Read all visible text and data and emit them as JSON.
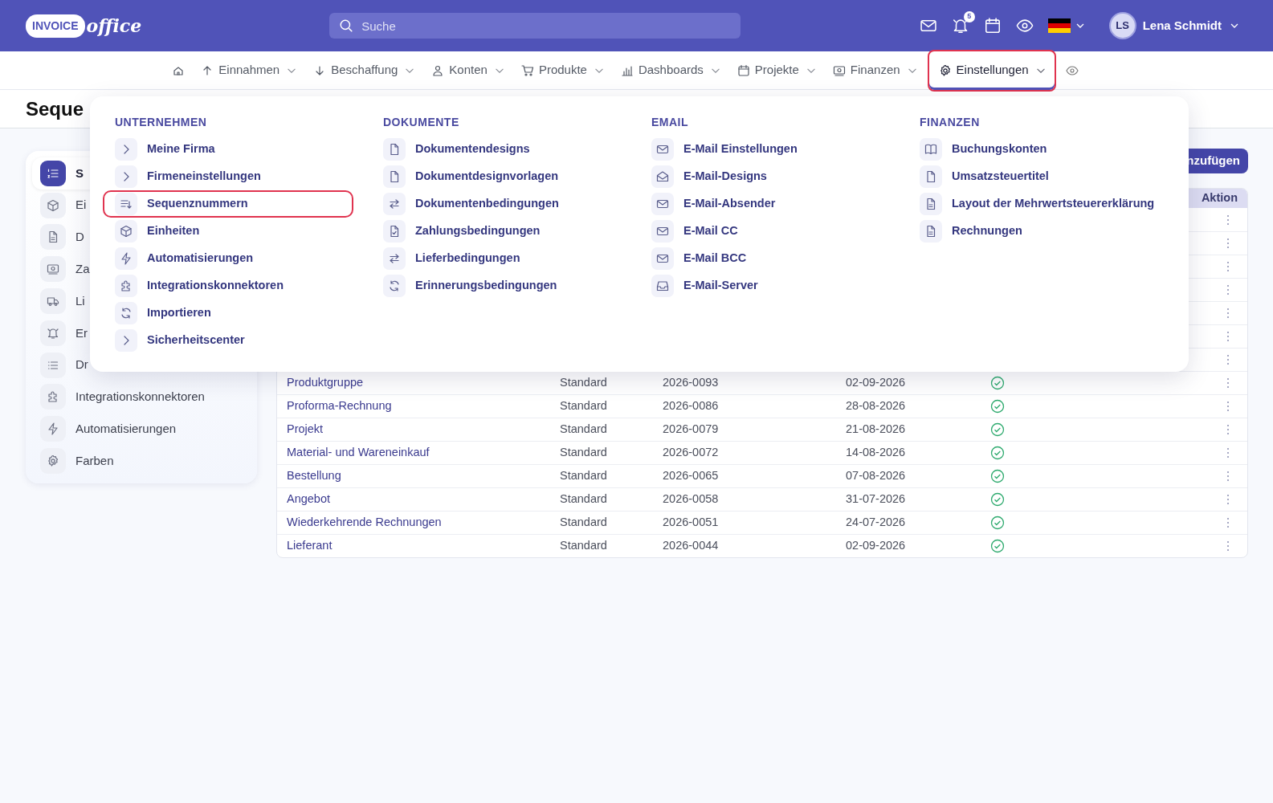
{
  "topbar": {
    "logo": {
      "badge_text": "INVOICE",
      "script_text": "office"
    },
    "search": {
      "placeholder": "Suche"
    },
    "notifications_count": "5",
    "user": {
      "initials": "LS",
      "name": "Lena Schmidt"
    }
  },
  "nav": {
    "items": [
      {
        "label": "Einnahmen",
        "selected": false
      },
      {
        "label": "Beschaffung",
        "selected": false
      },
      {
        "label": "Konten",
        "selected": false
      },
      {
        "label": "Produkte",
        "selected": false
      },
      {
        "label": "Dashboards",
        "selected": false
      },
      {
        "label": "Projekte",
        "selected": false
      },
      {
        "label": "Finanzen",
        "selected": false
      },
      {
        "label": "Einstellungen",
        "selected": true
      }
    ]
  },
  "page_title": "Seque",
  "sidebar": {
    "items": [
      {
        "label": "S",
        "selected": true
      },
      {
        "label": "Ei",
        "selected": false
      },
      {
        "label": "D",
        "selected": false
      },
      {
        "label": "Za",
        "selected": false
      },
      {
        "label": "Li",
        "selected": false
      },
      {
        "label": "Er",
        "selected": false
      },
      {
        "label": "Dr",
        "selected": false
      },
      {
        "label": "Integrationskonnektoren",
        "selected": false
      },
      {
        "label": "Automatisierungen",
        "selected": false
      },
      {
        "label": "Farben",
        "selected": false
      }
    ]
  },
  "add_button": "nzufügen",
  "table": {
    "columns": [
      "Aktion"
    ],
    "rows": [
      {
        "kind": "covered"
      },
      {
        "kind": "covered"
      },
      {
        "kind": "covered"
      },
      {
        "kind": "covered"
      },
      {
        "kind": "covered"
      },
      {
        "kind": "covered"
      },
      {
        "kind": "covered"
      },
      {
        "kind": "entry",
        "name": "Produktgruppe",
        "type": "Standard",
        "number": "2026-0093",
        "date": "02-09-2026",
        "active": true
      },
      {
        "kind": "entry",
        "name": "Proforma-Rechnung",
        "type": "Standard",
        "number": "2026-0086",
        "date": "28-08-2026",
        "active": true
      },
      {
        "kind": "entry",
        "name": "Projekt",
        "type": "Standard",
        "number": "2026-0079",
        "date": "21-08-2026",
        "active": true
      },
      {
        "kind": "entry",
        "name": "Material- und Wareneinkauf",
        "type": "Standard",
        "number": "2026-0072",
        "date": "14-08-2026",
        "active": true
      },
      {
        "kind": "entry",
        "name": "Bestellung",
        "type": "Standard",
        "number": "2026-0065",
        "date": "07-08-2026",
        "active": true
      },
      {
        "kind": "entry",
        "name": "Angebot",
        "type": "Standard",
        "number": "2026-0058",
        "date": "31-07-2026",
        "active": true
      },
      {
        "kind": "entry",
        "name": "Wiederkehrende Rechnungen",
        "type": "Standard",
        "number": "2026-0051",
        "date": "24-07-2026",
        "active": true
      },
      {
        "kind": "entry",
        "name": "Lieferant",
        "type": "Standard",
        "number": "2026-0044",
        "date": "02-09-2026",
        "active": true
      }
    ]
  },
  "menu": {
    "columns": [
      {
        "heading": "UNTERNEHMEN",
        "items": [
          {
            "label": "Meine Firma",
            "selected": false
          },
          {
            "label": "Firmeneinstellungen",
            "selected": false
          },
          {
            "label": "Sequenznummern",
            "selected": true
          },
          {
            "label": "Einheiten",
            "selected": false
          },
          {
            "label": "Automatisierungen",
            "selected": false
          },
          {
            "label": "Integrationskonnektoren",
            "selected": false
          },
          {
            "label": "Importieren",
            "selected": false
          },
          {
            "label": "Sicherheitscenter",
            "selected": false
          }
        ]
      },
      {
        "heading": "DOKUMENTE",
        "items": [
          {
            "label": "Dokumentendesigns",
            "selected": false
          },
          {
            "label": "Dokumentdesignvorlagen",
            "selected": false
          },
          {
            "label": "Dokumentenbedingungen",
            "selected": false
          },
          {
            "label": "Zahlungsbedingungen",
            "selected": false
          },
          {
            "label": "Lieferbedingungen",
            "selected": false
          },
          {
            "label": "Erinnerungsbedingungen",
            "selected": false
          }
        ]
      },
      {
        "heading": "EMAIL",
        "items": [
          {
            "label": "E-Mail Einstellungen",
            "selected": false
          },
          {
            "label": "E-Mail-Designs",
            "selected": false
          },
          {
            "label": "E-Mail-Absender",
            "selected": false
          },
          {
            "label": "E-Mail CC",
            "selected": false
          },
          {
            "label": "E-Mail BCC",
            "selected": false
          },
          {
            "label": "E-Mail-Server",
            "selected": false
          }
        ]
      },
      {
        "heading": "FINANZEN",
        "items": [
          {
            "label": "Buchungskonten",
            "selected": false
          },
          {
            "label": "Umsatzsteuertitel",
            "selected": false
          },
          {
            "label": "Layout der Mehrwertsteuererklärung",
            "selected": false
          },
          {
            "label": "Rechnungen",
            "selected": false
          }
        ]
      }
    ]
  }
}
